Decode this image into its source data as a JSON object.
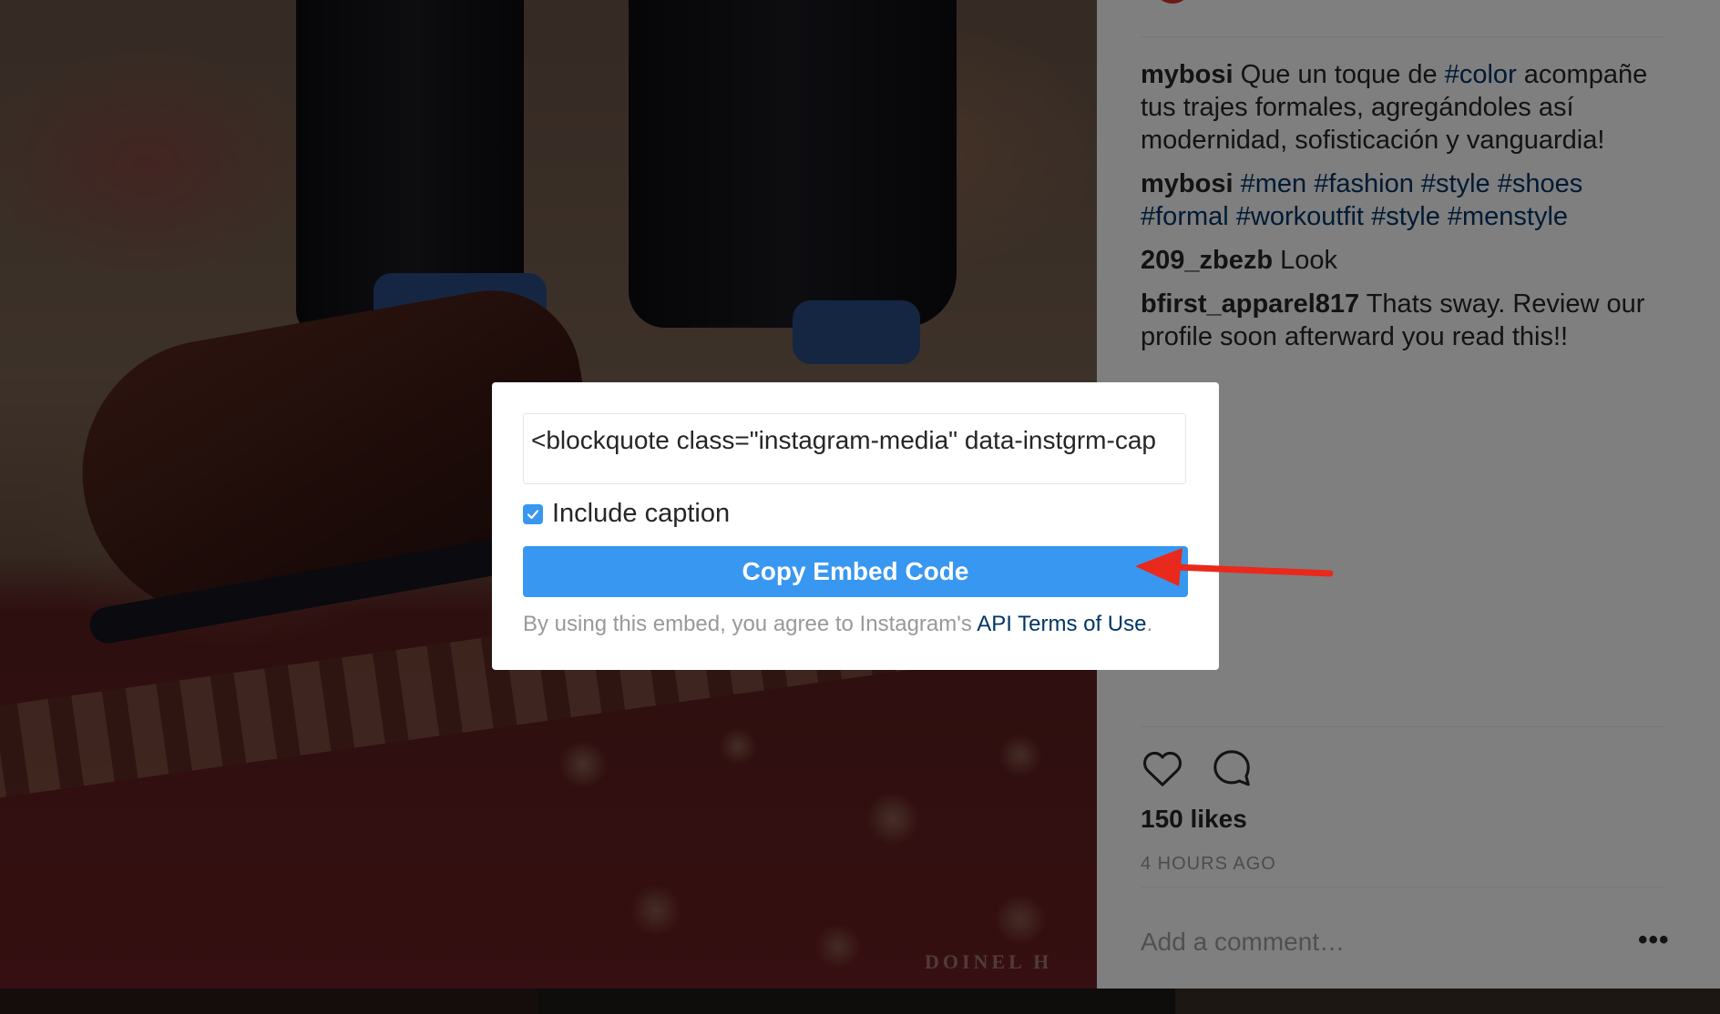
{
  "photo": {
    "watermark": "DOINEL H"
  },
  "comments": [
    {
      "user": "mybosi",
      "parts": [
        {
          "text": "Que un toque de ",
          "tag": false
        },
        {
          "text": "#color",
          "tag": true
        },
        {
          "text": " acompañe tus trajes formales, agregándoles así modernidad, sofisticación y vanguardia!",
          "tag": false
        }
      ]
    },
    {
      "user": "mybosi",
      "parts": [
        {
          "text": "#men",
          "tag": true
        },
        {
          "text": " ",
          "tag": false
        },
        {
          "text": "#fashion",
          "tag": true
        },
        {
          "text": " ",
          "tag": false
        },
        {
          "text": "#style",
          "tag": true
        },
        {
          "text": " ",
          "tag": false
        },
        {
          "text": "#shoes",
          "tag": true
        },
        {
          "text": " ",
          "tag": false
        },
        {
          "text": "#formal",
          "tag": true
        },
        {
          "text": " ",
          "tag": false
        },
        {
          "text": "#workoutfit",
          "tag": true
        },
        {
          "text": " ",
          "tag": false
        },
        {
          "text": "#style",
          "tag": true
        },
        {
          "text": " ",
          "tag": false
        },
        {
          "text": "#menstyle",
          "tag": true
        }
      ]
    },
    {
      "user": "209_zbezb",
      "parts": [
        {
          "text": "Look",
          "tag": false
        }
      ]
    },
    {
      "user": "bfirst_apparel817",
      "parts": [
        {
          "text": "Thats sway. Review our profile soon afterward you read this!!",
          "tag": false
        }
      ]
    }
  ],
  "post": {
    "like_icon": "heart-icon",
    "comment_icon": "comment-icon",
    "likes": "150 likes",
    "time": "4 HOURS AGO",
    "comment_placeholder": "Add a comment…",
    "more_label": "•••"
  },
  "modal": {
    "embed_code": "<blockquote class=\"instagram-media\" data-instgrm-cap",
    "include_caption_label": "Include caption",
    "include_caption_checked": true,
    "copy_button_label": "Copy Embed Code",
    "terms_prefix": "By using this embed, you agree to Instagram's ",
    "terms_link": "API Terms of Use",
    "terms_suffix": "."
  },
  "colors": {
    "accent": "#3897f0",
    "link": "#003569",
    "annotation_arrow": "#e8291c"
  }
}
